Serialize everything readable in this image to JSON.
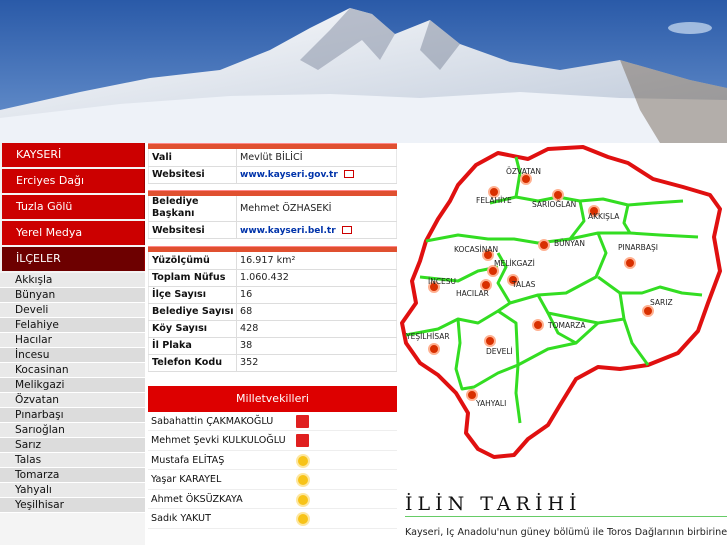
{
  "sidebar": {
    "nav": [
      {
        "label": "KAYSERİ"
      },
      {
        "label": "Erciyes Dağı"
      },
      {
        "label": "Tuzla Gölü"
      },
      {
        "label": "Yerel Medya"
      },
      {
        "label": "İLÇELER"
      }
    ],
    "districts": [
      "Akkışla",
      "Bünyan",
      "Develi",
      "Felahiye",
      "Hacılar",
      "İncesu",
      "Kocasinan",
      "Melikgazi",
      "Özvatan",
      "Pınarbaşı",
      "Sarıoğlan",
      "Sarız",
      "Talas",
      "Tomarza",
      "Yahyalı",
      "Yeşilhisar"
    ]
  },
  "governor": {
    "label": "Vali",
    "value": "Mevlüt BİLİCİ",
    "web_label": "Websitesi",
    "web": "www.kayseri.gov.tr"
  },
  "mayor": {
    "label": "Belediye Başkanı",
    "value": "Mehmet ÖZHASEKİ",
    "web_label": "Websitesi",
    "web": "www.kayseri.bel.tr"
  },
  "stats": [
    {
      "k": "Yüzölçümü",
      "v": "16.917 km²"
    },
    {
      "k": "Toplam Nüfus",
      "v": "1.060.432"
    },
    {
      "k": "İlçe Sayısı",
      "v": "16"
    },
    {
      "k": "Belediye Sayısı",
      "v": "68"
    },
    {
      "k": "Köy Sayısı",
      "v": "428"
    },
    {
      "k": "İl Plaka",
      "v": "38"
    },
    {
      "k": "Telefon Kodu",
      "v": "352"
    }
  ],
  "mps": {
    "title": "Milletvekilleri",
    "items": [
      {
        "name": "Sabahattin ÇAKMAKOĞLU",
        "party": "mhp-logo"
      },
      {
        "name": "Mehmet Şevki KULKULOĞLU",
        "party": "chp-logo"
      },
      {
        "name": "Mustafa ELİTAŞ",
        "party": "akp-logo"
      },
      {
        "name": "Yaşar KARAYEL",
        "party": "akp-logo"
      },
      {
        "name": "Ahmet ÖKSÜZKAYA",
        "party": "akp-logo"
      },
      {
        "name": "Sadık YAKUT",
        "party": "akp-logo"
      }
    ]
  },
  "map": {
    "labels": [
      "ÖZVATAN",
      "FELAHİYE",
      "SARIOĞLAN",
      "AKKIŞLA",
      "KOCASİNAN",
      "BÜNYAN",
      "MELİKGAZİ",
      "PINARBAŞI",
      "İNCESU",
      "TALAS",
      "HACILAR",
      "SARIZ",
      "TOMARZA",
      "YEŞİLHİSAR",
      "DEVELİ",
      "YAHYALI"
    ],
    "colors": {
      "border": "#e01010",
      "internal": "#33dd22",
      "marker": "#d83000"
    }
  },
  "history": {
    "title": "İLİN TARİHİ",
    "text": "Kayseri, İç Anadolu'nun güney bölümü ile Toros Dağlarının birbirine"
  }
}
